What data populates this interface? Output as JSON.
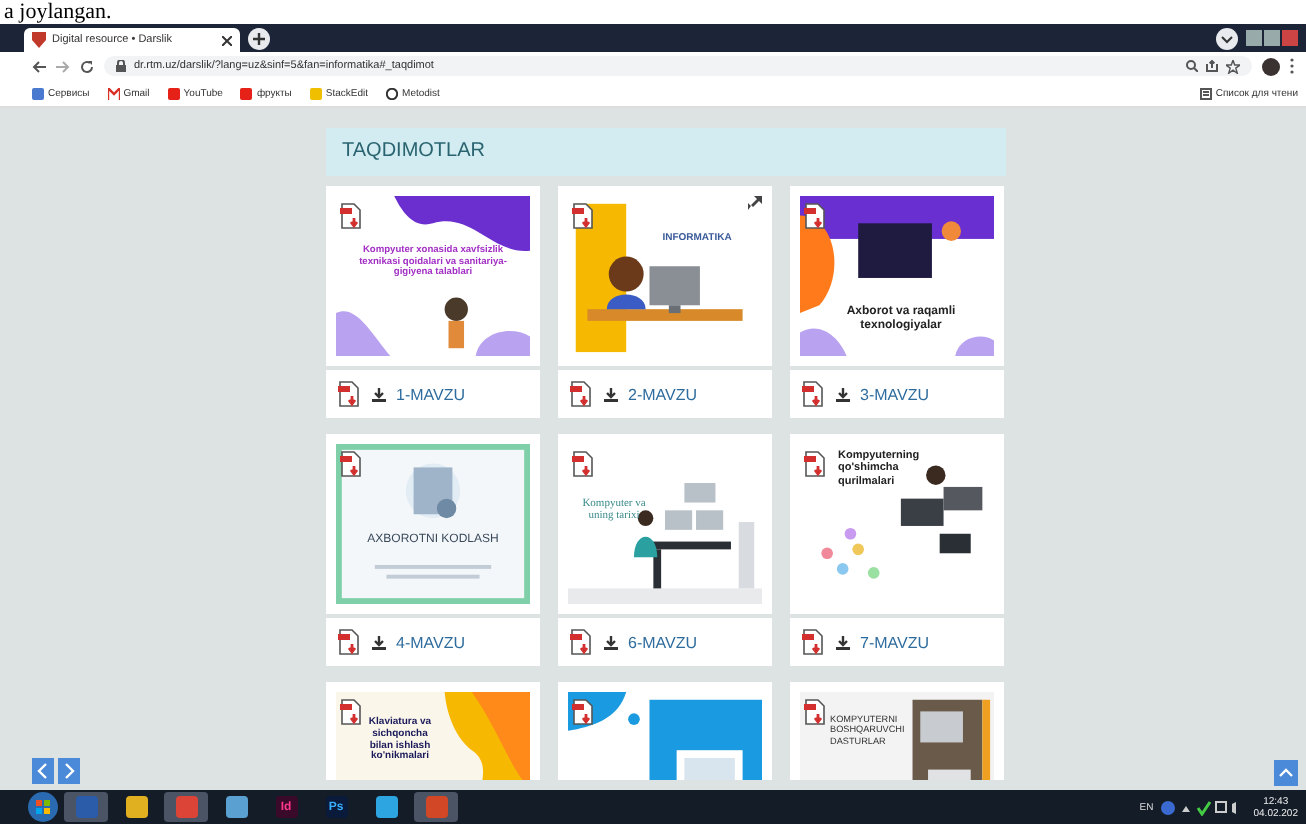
{
  "document_fragment": "a joylangan.",
  "browser": {
    "tab_title": "Digital resource • Darslik",
    "url": "dr.rtm.uz/darslik/?lang=uz&sinf=5&fan=informatika#_taqdimot",
    "bookmarks": [
      {
        "kind": "apps",
        "label": "Сервисы"
      },
      {
        "kind": "gmail",
        "label": "Gmail"
      },
      {
        "kind": "youtube",
        "label": "YouTube"
      },
      {
        "kind": "youtube",
        "label": "фрукты"
      },
      {
        "kind": "stackedit",
        "label": "StackEdit"
      },
      {
        "kind": "globe",
        "label": "Metodist"
      }
    ],
    "reading_list": "Список для чтени"
  },
  "section_title": "TAQDIMOTLAR",
  "cards": [
    {
      "kind": "purple-wave",
      "slide_title": "Kompyuter xonasida xavfsizlik texnikasi qoidalari va sanitariya-gigiyena talablari",
      "label": "1-MAVZU",
      "expand": false
    },
    {
      "kind": "yellow-girl",
      "slide_title": "INFORMATIKA",
      "label": "2-MAVZU",
      "expand": true
    },
    {
      "kind": "orange-tech",
      "slide_title": "Axborot va raqamli texnologiyalar",
      "label": "3-MAVZU",
      "expand": false
    },
    {
      "kind": "green-frame",
      "slide_title": "AXBOROTNI KODLASH",
      "label": "4-MAVZU",
      "expand": false
    },
    {
      "kind": "office",
      "slide_title": "Kompyuter va uning tarixi",
      "label": "6-MAVZU",
      "expand": false
    },
    {
      "kind": "devices",
      "slide_title": "Kompyuterning qo'shimcha qurilmalari",
      "label": "7-MAVZU",
      "expand": false
    },
    {
      "kind": "yellow-orange",
      "slide_title": "Klaviatura va sichqoncha bilan ishlash ko'nikmalari",
      "expand": false
    },
    {
      "kind": "blue-screen",
      "expand": false
    },
    {
      "kind": "photo-desk",
      "slide_title": "KOMPYUTERNI BOSHQARUVCHI DASTURLAR",
      "expand": false
    }
  ],
  "taskbar": {
    "apps": [
      {
        "kind": "word",
        "active": true
      },
      {
        "kind": "app",
        "active": false
      },
      {
        "kind": "chrome",
        "active": true
      },
      {
        "kind": "camera",
        "active": false
      },
      {
        "kind": "indesign",
        "label": "Id",
        "active": false
      },
      {
        "kind": "photoshop",
        "label": "Ps",
        "active": false
      },
      {
        "kind": "telegram",
        "active": false
      },
      {
        "kind": "powerpoint",
        "active": true
      }
    ],
    "language": "EN",
    "time": "12:43",
    "date": "04.02.202"
  }
}
